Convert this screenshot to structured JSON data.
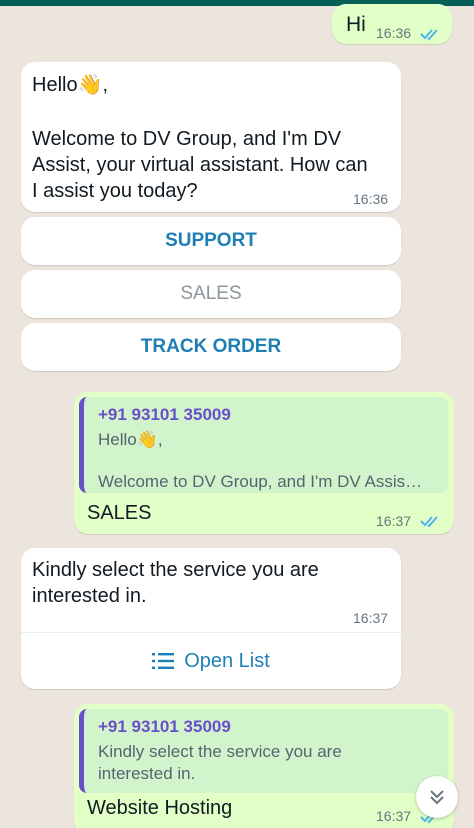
{
  "colors": {
    "chat_background": "#ece5dd",
    "incoming_bubble": "#ffffff",
    "outgoing_bubble": "#e1ffc7",
    "quote_accent": "#6a4fc9",
    "link_blue": "#1f7fb5",
    "read_ticks": "#4fb6ec"
  },
  "messages": {
    "hi": {
      "text": "Hi",
      "time": "16:36",
      "status": "read"
    },
    "welcome": {
      "line1_prefix": "Hello",
      "wave_emoji": "👋",
      "line1_suffix": ",",
      "line2": "Welcome to DV Group, and I'm DV",
      "line3": "Assist, your virtual assistant. How can",
      "line4": "I assist you today?",
      "time": "16:36",
      "buttons": {
        "support": "SUPPORT",
        "sales": "SALES",
        "track_order": "TRACK ORDER"
      }
    },
    "sales_reply": {
      "quote_sender": "+91 93101 35009",
      "quote_line1_prefix": "Hello",
      "quote_wave": "👋",
      "quote_line1_suffix": ",",
      "quote_line2": "Welcome to DV Group, and I'm DV Assis…",
      "text": "SALES",
      "time": "16:37",
      "status": "read"
    },
    "select_service": {
      "line1": "Kindly select the service you are",
      "line2": "interested in.",
      "time": "16:37",
      "open_list_label": "Open List",
      "open_list_icon": "list-icon"
    },
    "website_reply": {
      "quote_sender": "+91 93101 35009",
      "quote_line1": "Kindly select the service you are",
      "quote_line2": "interested in.",
      "text": "Website Hosting",
      "time": "16:37",
      "status": "read"
    }
  },
  "scroll_button_icon": "double-chevron-down-icon"
}
